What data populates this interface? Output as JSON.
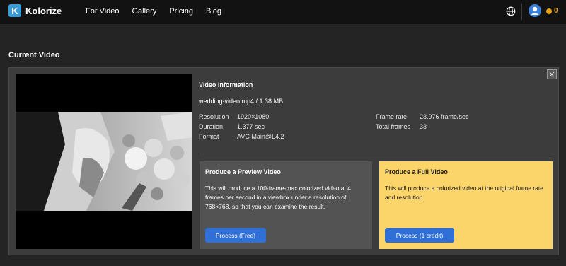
{
  "app": {
    "name": "Kolorize",
    "logo_letter": "K"
  },
  "nav": {
    "items": [
      "For Video",
      "Gallery",
      "Pricing",
      "Blog"
    ]
  },
  "header": {
    "credits": "0"
  },
  "page": {
    "section_title": "Current Video"
  },
  "video_info": {
    "title": "Video Information",
    "file": "wedding-video.mp4 / 1.38 MB",
    "left": [
      {
        "label": "Resolution",
        "value": "1920×1080"
      },
      {
        "label": "Duration",
        "value": "1.377 sec"
      },
      {
        "label": "Format",
        "value": "AVC Main@L4.2"
      }
    ],
    "right": [
      {
        "label": "Frame rate",
        "value": "23.976 frame/sec"
      },
      {
        "label": "Total frames",
        "value": "33"
      }
    ]
  },
  "preview": {
    "title": "Produce a Preview Video",
    "desc": "This will produce a 100-frame-max colorized video at 4 frames per second in a viewbox under a resolution of 768×768, so that you can examine the result.",
    "button": "Process (Free)"
  },
  "full": {
    "title": "Produce a Full Video",
    "desc": "This will produce a colorized video at the original frame rate and resolution.",
    "button": "Process (1 credit)"
  },
  "colors": {
    "accent": "#2f6fd6",
    "full_panel": "#fcd56a",
    "coin": "#e8a317"
  }
}
